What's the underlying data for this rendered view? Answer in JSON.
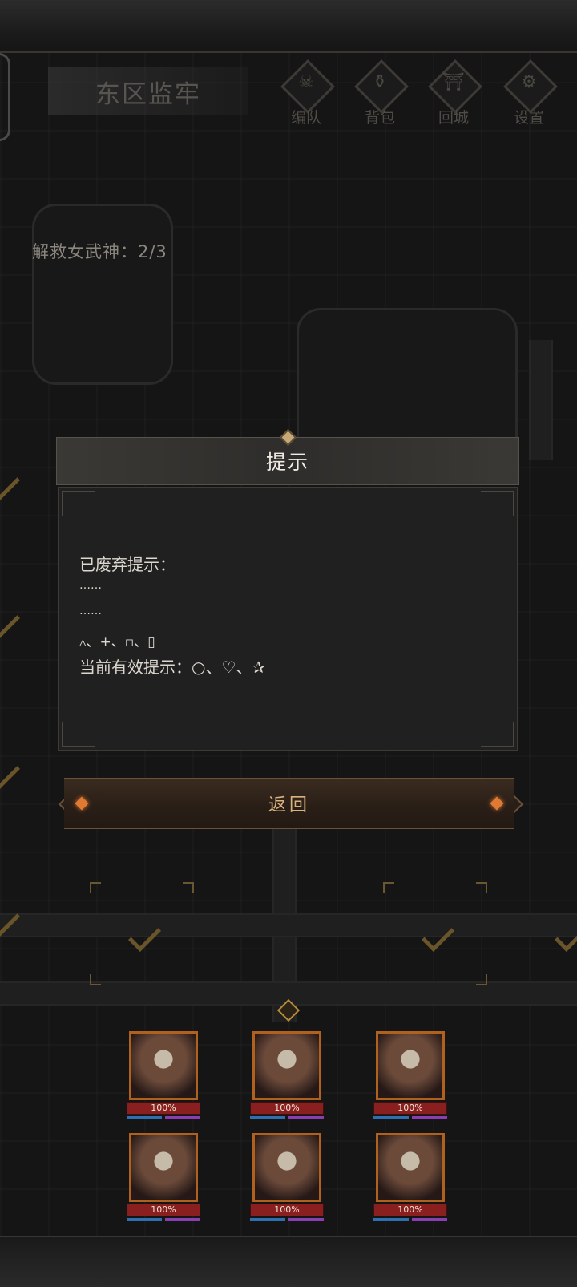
{
  "location": {
    "title": "东区监牢"
  },
  "menu": [
    {
      "label": "编队",
      "icon": "skull-icon",
      "glyph": "☠"
    },
    {
      "label": "背包",
      "icon": "bag-icon",
      "glyph": "⚱"
    },
    {
      "label": "回城",
      "icon": "door-icon",
      "glyph": "⛩"
    },
    {
      "label": "设置",
      "icon": "gear-icon",
      "glyph": "⚙"
    }
  ],
  "objective": {
    "text": "解救女武神：2/3"
  },
  "dialog": {
    "title": "提示",
    "lines": [
      "已废弃提示：",
      "……",
      "……",
      "▵、+、▫、▯",
      "当前有效提示：○、♡、✰"
    ]
  },
  "return_button": {
    "label": "返回"
  },
  "party": [
    {
      "hp": "100%"
    },
    {
      "hp": "100%"
    },
    {
      "hp": "100%"
    },
    {
      "hp": "100%"
    },
    {
      "hp": "100%"
    },
    {
      "hp": "100%"
    }
  ],
  "colors": {
    "accent": "#d9b27e",
    "hp": "#8a1f1f",
    "mp": "#2f6fb0",
    "sp": "#8a3fb0"
  }
}
